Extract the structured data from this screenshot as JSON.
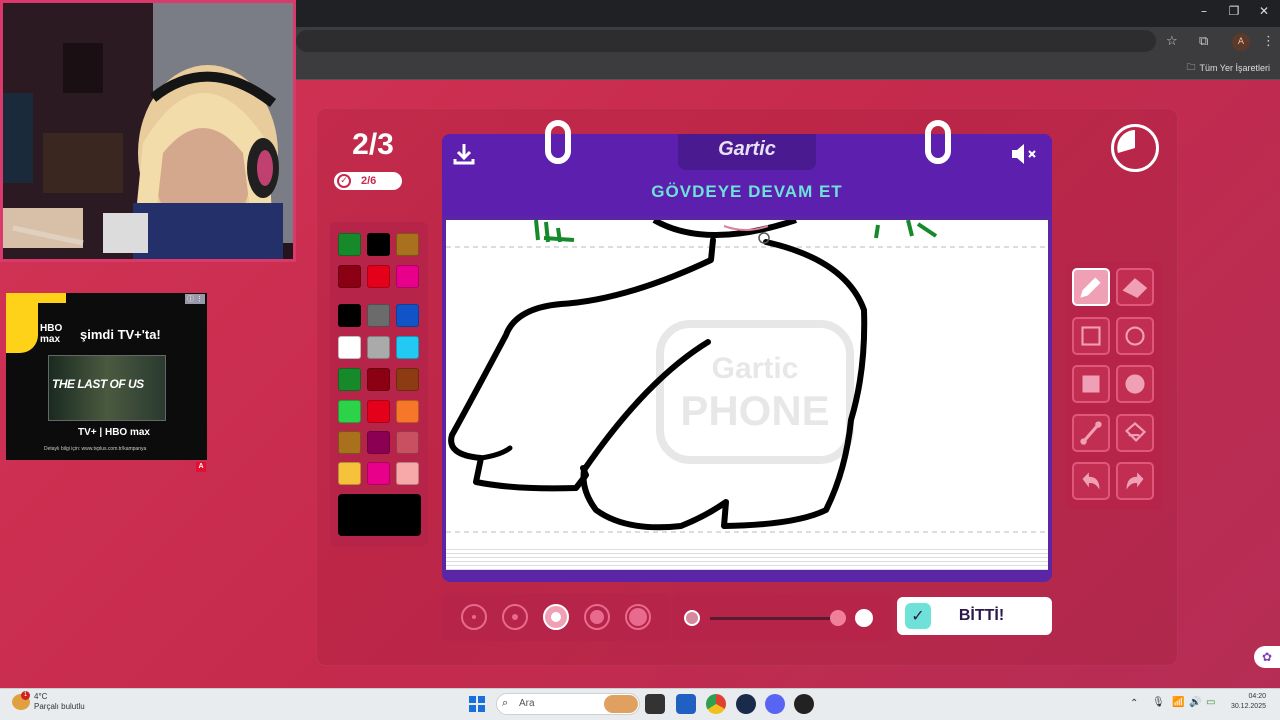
{
  "browser": {
    "bookmarks_label": "Tüm Yer İşaretleri"
  },
  "game": {
    "round": "2/3",
    "done_count": "2/6",
    "logo": "Gartic",
    "prompt": "GÖVDEYE DEVAM ET",
    "done_button": "BİTTİ!",
    "watermark_top": "Gartic",
    "watermark_bottom": "PHONE",
    "palette_colors": [
      "#168a2a",
      "#000000",
      "#a9711d",
      "#8b0012",
      "#e4001b",
      "#e8008a",
      "#000000",
      "#6b6b6b",
      "#1054c8",
      "#ffffff",
      "#aaaaaa",
      "#22c9f2",
      "#168a2a",
      "#8b0012",
      "#8c3b12",
      "#2cd348",
      "#e4001b",
      "#f6762a",
      "#a9711d",
      "#8b0053",
      "#c85060",
      "#f7c23b",
      "#e8008a",
      "#f7a8a8"
    ],
    "current_color": "#000000",
    "brush_sizes": [
      "1",
      "2",
      "3",
      "4",
      "5"
    ],
    "selected_brush": "3",
    "tools": [
      "pencil-icon",
      "eraser-icon",
      "rectangle-outline-icon",
      "circle-outline-icon",
      "rectangle-filled-icon",
      "circle-filled-icon",
      "line-icon",
      "fill-bucket-icon",
      "undo-icon",
      "redo-icon"
    ],
    "selected_tool": "pencil-icon"
  },
  "ad": {
    "line1": "HBO max",
    "line2": "şimdi TV+'ta!",
    "movie": "THE LAST OF US",
    "footer": "Detaylı bilgi için: www.tvplus.com.tr/kampanya"
  },
  "taskbar": {
    "weather_temp": "4°C",
    "weather_desc": "Parçalı bulutlu",
    "search_placeholder": "Ara",
    "time": "04:20",
    "date": "30.12.2025"
  }
}
